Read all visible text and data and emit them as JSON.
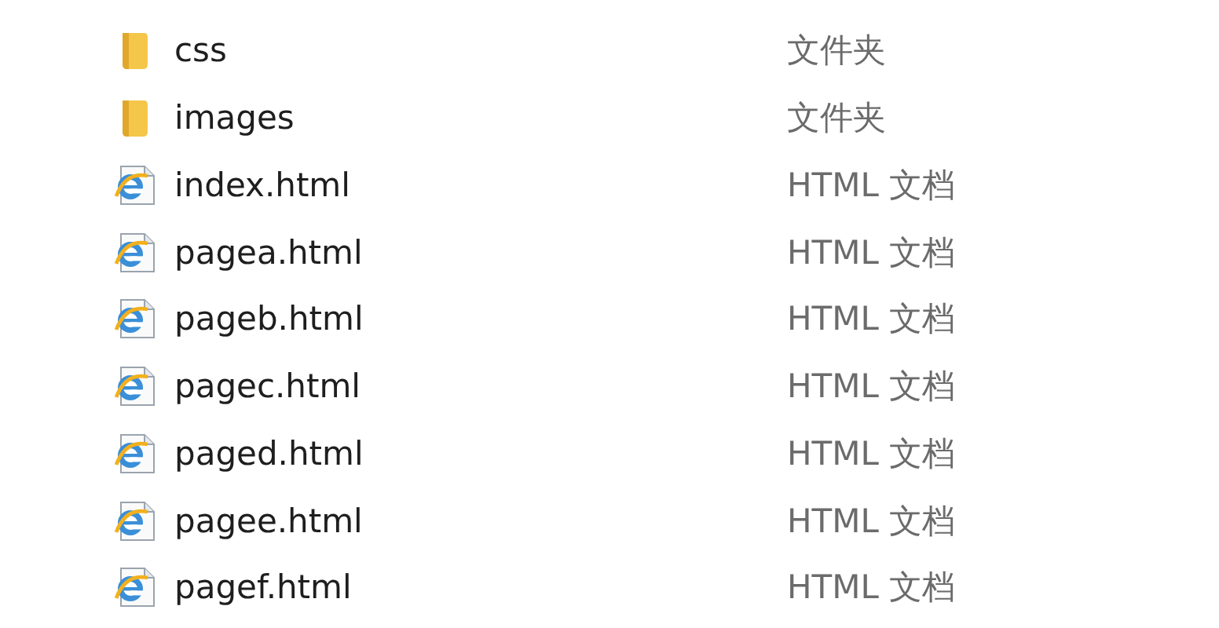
{
  "files": [
    {
      "kind": "folder",
      "name": "css",
      "type": "文件夹"
    },
    {
      "kind": "folder",
      "name": "images",
      "type": "文件夹"
    },
    {
      "kind": "html",
      "name": "index.html",
      "type": "HTML 文档"
    },
    {
      "kind": "html",
      "name": "pagea.html",
      "type": "HTML 文档"
    },
    {
      "kind": "html",
      "name": "pageb.html",
      "type": "HTML 文档"
    },
    {
      "kind": "html",
      "name": "pagec.html",
      "type": "HTML 文档"
    },
    {
      "kind": "html",
      "name": "paged.html",
      "type": "HTML 文档"
    },
    {
      "kind": "html",
      "name": "pagee.html",
      "type": "HTML 文档"
    },
    {
      "kind": "html",
      "name": "pagef.html",
      "type": "HTML 文档"
    }
  ]
}
